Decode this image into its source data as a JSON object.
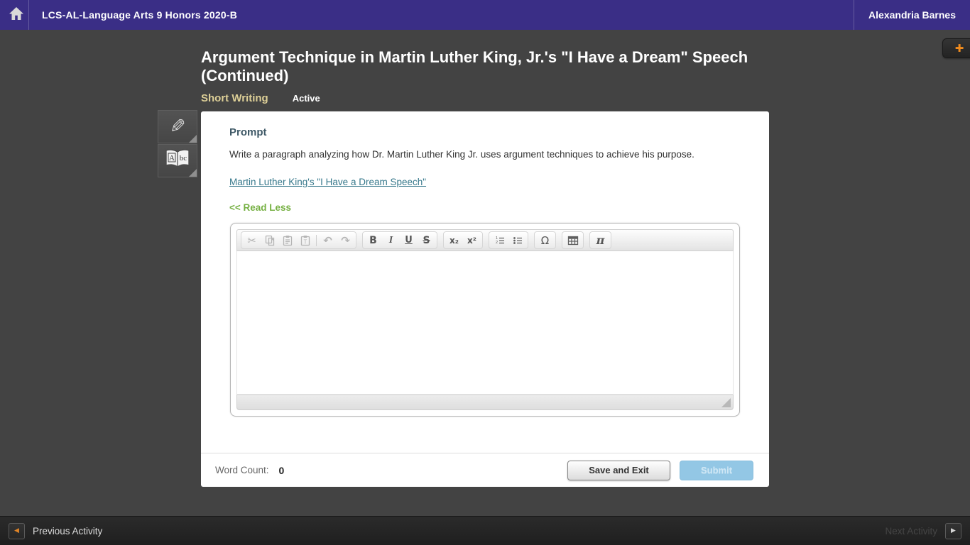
{
  "header": {
    "course_title": "LCS-AL-Language Arts 9 Honors 2020-B",
    "user_name": "Alexandria Barnes"
  },
  "activity": {
    "title": "Argument Technique in Martin Luther King, Jr.'s \"I Have a Dream\" Speech (Continued)",
    "type_label": "Short Writing",
    "status_label": "Active",
    "add_button_glyph": "✚"
  },
  "tools": {
    "highlighter_glyph": "✎",
    "dictionary_left": "A",
    "dictionary_right": "bc"
  },
  "prompt": {
    "heading": "Prompt",
    "body": "Write a paragraph analyzing how Dr. Martin Luther King Jr. uses argument techniques to achieve his purpose.",
    "resource_link": "Martin Luther King's \"I Have a Dream Speech\"",
    "read_less": "<< Read Less"
  },
  "editor": {
    "content": "",
    "glyphs": {
      "cut": "✂",
      "undo": "↶",
      "redo": "↷",
      "bold": "B",
      "italic": "I",
      "underline": "U",
      "strikethrough": "S",
      "subscript": "x₂",
      "superscript": "x²",
      "special_character": "Ω",
      "math": "π"
    }
  },
  "status_bar": {
    "word_count_label": "Word Count:",
    "word_count_value": "0",
    "save_button": "Save and Exit",
    "submit_button": "Submit"
  },
  "footer": {
    "previous_label": "Previous Activity",
    "next_label": "Next Activity",
    "prev_glyph": "◀",
    "next_glyph": "▶"
  },
  "colors": {
    "header_bg": "#3a2e86",
    "page_bg": "#434343",
    "accent_orange": "#ef8b1e",
    "type_label_gold": "#ddcf97",
    "link_teal": "#36788b",
    "read_less_green": "#76b043",
    "prompt_heading": "#3e5866",
    "submit_blue": "#93c7e5",
    "footer_bg": "#252525"
  }
}
